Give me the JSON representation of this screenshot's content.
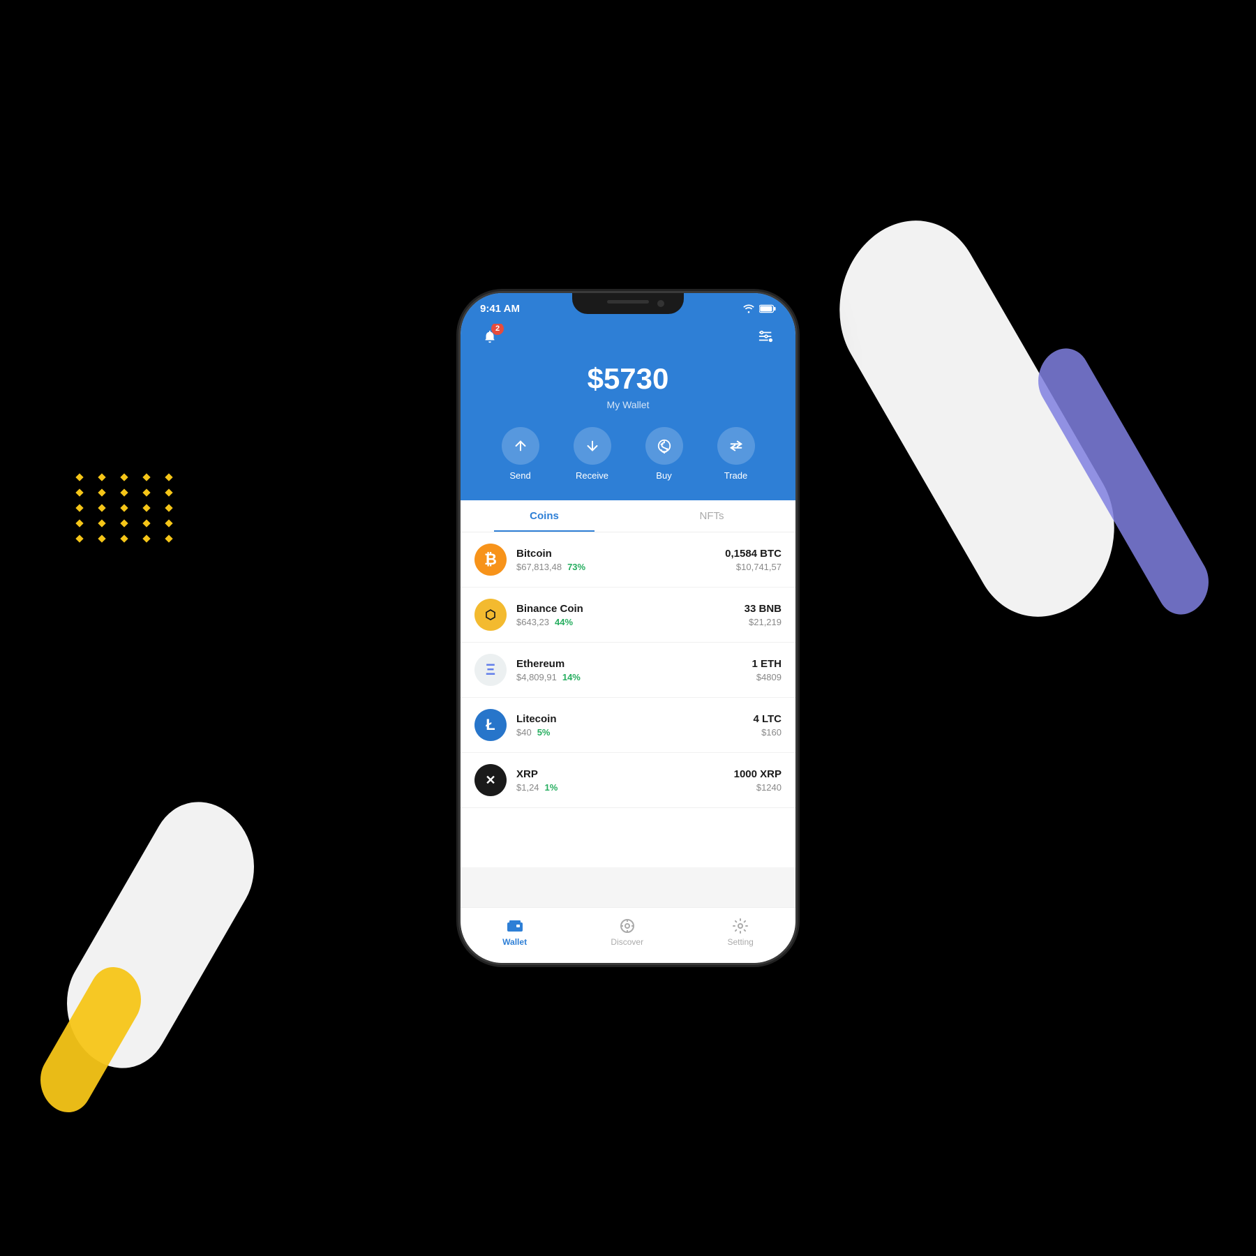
{
  "background": "#000",
  "decorations": {
    "dot_color": "#f5c518",
    "ribbon_white": "#fff",
    "ribbon_blue": "#8080e0",
    "ribbon_yellow": "#f5c518"
  },
  "status_bar": {
    "time": "9:41 AM",
    "wifi": "wifi",
    "battery": "battery"
  },
  "header": {
    "balance": "$5730",
    "wallet_label": "My Wallet",
    "notification_count": "2",
    "actions": [
      {
        "id": "send",
        "label": "Send"
      },
      {
        "id": "receive",
        "label": "Receive"
      },
      {
        "id": "buy",
        "label": "Buy"
      },
      {
        "id": "trade",
        "label": "Trade"
      }
    ]
  },
  "tabs": [
    {
      "id": "coins",
      "label": "Coins",
      "active": true
    },
    {
      "id": "nfts",
      "label": "NFTs",
      "active": false
    }
  ],
  "coins": [
    {
      "name": "Bitcoin",
      "symbol": "BTC",
      "price": "$67,813,48",
      "change": "73%",
      "amount": "0,1584 BTC",
      "value": "$10,741,57",
      "icon_text": "₿",
      "icon_class": "btc-bg"
    },
    {
      "name": "Binance Coin",
      "symbol": "BNB",
      "price": "$643,23",
      "change": "44%",
      "amount": "33 BNB",
      "value": "$21,219",
      "icon_text": "◈",
      "icon_class": "bnb-bg"
    },
    {
      "name": "Ethereum",
      "symbol": "ETH",
      "price": "$4,809,91",
      "change": "14%",
      "amount": "1 ETH",
      "value": "$4809",
      "icon_text": "Ξ",
      "icon_class": "eth-bg"
    },
    {
      "name": "Litecoin",
      "symbol": "LTC",
      "price": "$40",
      "change": "5%",
      "amount": "4 LTC",
      "value": "$160",
      "icon_text": "Ł",
      "icon_class": "ltc-bg"
    },
    {
      "name": "XRP",
      "symbol": "XRP",
      "price": "$1,24",
      "change": "1%",
      "amount": "1000 XRP",
      "value": "$1240",
      "icon_text": "✕",
      "icon_class": "xrp-bg"
    }
  ],
  "bottom_nav": [
    {
      "id": "wallet",
      "label": "Wallet",
      "active": true
    },
    {
      "id": "discover",
      "label": "Discover",
      "active": false
    },
    {
      "id": "setting",
      "label": "Setting",
      "active": false
    }
  ]
}
